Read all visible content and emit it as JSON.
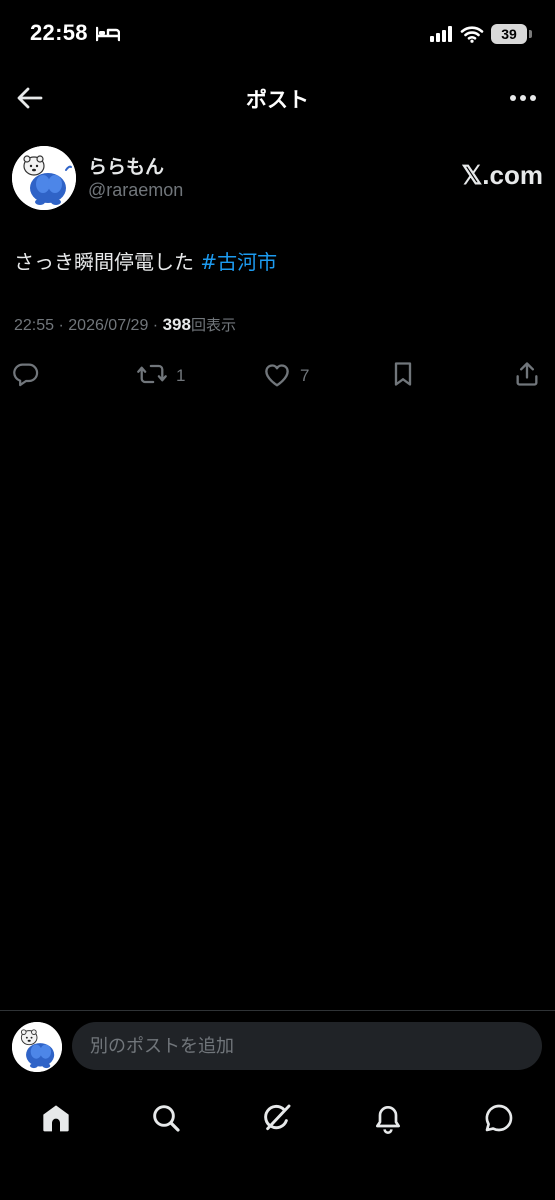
{
  "status_bar": {
    "time": "22:58",
    "battery": "39",
    "icons": [
      "bed-icon",
      "cellular-signal-icon",
      "wifi-icon",
      "battery-icon"
    ]
  },
  "header": {
    "title": "ポスト",
    "icons": [
      "back-arrow-icon",
      "more-icon"
    ]
  },
  "post": {
    "author_name": "ららもん",
    "author_handle": "@raraemon",
    "source": "𝕏.com",
    "text": "さっき瞬間停電した ",
    "hashtag": "#古河市",
    "time": "22:55",
    "separator": " · ",
    "date": "2026/07/29",
    "views_count": "398",
    "views_label": "回表示"
  },
  "actions": {
    "reply_count": "",
    "repost_count": "1",
    "like_count": "7",
    "icons": [
      "reply-icon",
      "repost-icon",
      "like-icon",
      "bookmark-icon",
      "share-icon"
    ]
  },
  "composer": {
    "placeholder": "別のポストを追加"
  },
  "bottom_nav": {
    "items": [
      "home-icon",
      "search-icon",
      "grok-icon",
      "notifications-icon",
      "messages-icon"
    ]
  },
  "colors": {
    "background": "#000000",
    "text": "#e7e9ea",
    "secondary": "#71767b",
    "accent": "#1d9bf0"
  }
}
